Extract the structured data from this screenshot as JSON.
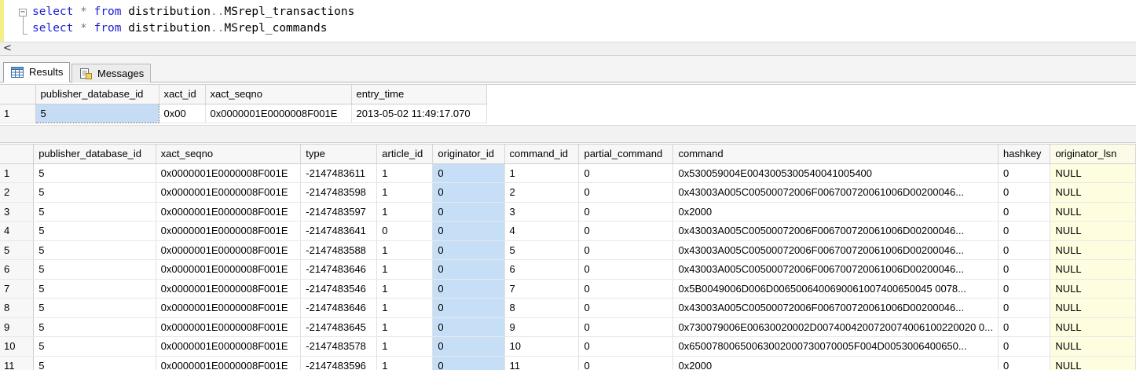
{
  "editor": {
    "lines": [
      {
        "kw1": "select",
        "op": "*",
        "kw2": "from",
        "db": "distribution",
        "table": "MSrepl_transactions"
      },
      {
        "kw1": "select",
        "op": "*",
        "kw2": "from",
        "db": "distribution",
        "table": "MSrepl_commands"
      }
    ],
    "fold_symbol": "−"
  },
  "hscroll": {
    "left_arrow": "<"
  },
  "tabs": [
    {
      "label": "Results",
      "icon": "grid-results-icon",
      "active": true
    },
    {
      "label": "Messages",
      "icon": "messages-icon",
      "active": false
    }
  ],
  "grid1": {
    "columns": [
      "publisher_database_id",
      "xact_id",
      "xact_seqno",
      "entry_time"
    ],
    "rows": [
      {
        "num": "1",
        "cells": [
          "5",
          "0x00",
          "0x0000001E0000008F001E",
          "2013-05-02 11:49:17.070"
        ]
      }
    ]
  },
  "grid2": {
    "columns": [
      "publisher_database_id",
      "xact_seqno",
      "type",
      "article_id",
      "originator_id",
      "command_id",
      "partial_command",
      "command",
      "hashkey",
      "originator_lsn"
    ],
    "rows": [
      {
        "num": "1",
        "cells": [
          "5",
          "0x0000001E0000008F001E",
          "-2147483611",
          "1",
          "0",
          "1",
          "0",
          "0x530059004E0043005300540041005400",
          "0",
          "NULL"
        ]
      },
      {
        "num": "2",
        "cells": [
          "5",
          "0x0000001E0000008F001E",
          "-2147483598",
          "1",
          "0",
          "2",
          "0",
          "0x43003A005C00500072006F006700720061006D00200046...",
          "0",
          "NULL"
        ]
      },
      {
        "num": "3",
        "cells": [
          "5",
          "0x0000001E0000008F001E",
          "-2147483597",
          "1",
          "0",
          "3",
          "0",
          "0x2000",
          "0",
          "NULL"
        ]
      },
      {
        "num": "4",
        "cells": [
          "5",
          "0x0000001E0000008F001E",
          "-2147483641",
          "0",
          "0",
          "4",
          "0",
          "0x43003A005C00500072006F006700720061006D00200046...",
          "0",
          "NULL"
        ]
      },
      {
        "num": "5",
        "cells": [
          "5",
          "0x0000001E0000008F001E",
          "-2147483588",
          "1",
          "0",
          "5",
          "0",
          "0x43003A005C00500072006F006700720061006D00200046...",
          "0",
          "NULL"
        ]
      },
      {
        "num": "6",
        "cells": [
          "5",
          "0x0000001E0000008F001E",
          "-2147483646",
          "1",
          "0",
          "6",
          "0",
          "0x43003A005C00500072006F006700720061006D00200046...",
          "0",
          "NULL"
        ]
      },
      {
        "num": "7",
        "cells": [
          "5",
          "0x0000001E0000008F001E",
          "-2147483546",
          "1",
          "0",
          "7",
          "0",
          "0x5B0049006D006D0065006400690061007400650045 0078...",
          "0",
          "NULL"
        ]
      },
      {
        "num": "8",
        "cells": [
          "5",
          "0x0000001E0000008F001E",
          "-2147483646",
          "1",
          "0",
          "8",
          "0",
          "0x43003A005C00500072006F006700720061006D00200046...",
          "0",
          "NULL"
        ]
      },
      {
        "num": "9",
        "cells": [
          "5",
          "0x0000001E0000008F001E",
          "-2147483645",
          "1",
          "0",
          "9",
          "0",
          "0x730079006E00630020002D0074004200720074006100220020 0...",
          "0",
          "NULL"
        ]
      },
      {
        "num": "10",
        "cells": [
          "5",
          "0x0000001E0000008F001E",
          "-2147483578",
          "1",
          "0",
          "10",
          "0",
          "0x65007800650063002000730070005F004D0053006400650...",
          "0",
          "NULL"
        ]
      },
      {
        "num": "11",
        "cells": [
          "5",
          "0x0000001E0000008F001E",
          "-2147483596",
          "1",
          "0",
          "11",
          "0",
          "0x2000",
          "0",
          "NULL"
        ]
      }
    ]
  },
  "colors": {
    "keyword": "#1d1dd6",
    "selected_cell": "#c6dcf5",
    "command_id_highlight": "#c7dff6",
    "null_highlight": "#fffde0",
    "gutter_marker": "#f3f08a"
  }
}
